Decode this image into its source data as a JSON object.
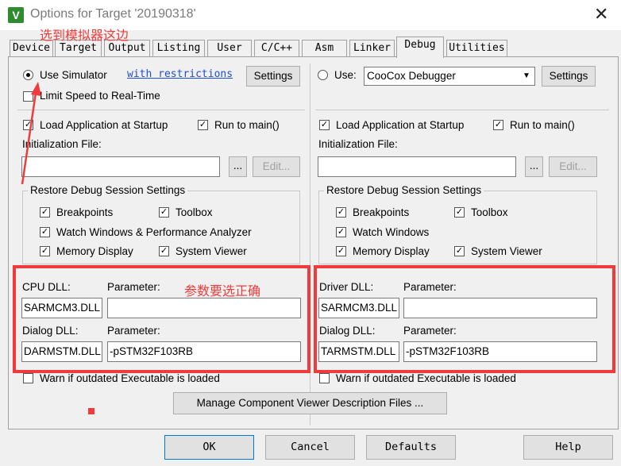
{
  "window": {
    "title": "Options for Target '20190318'",
    "icon": "keil-app-icon",
    "close_label": "✕"
  },
  "tabs": [
    "Device",
    "Target",
    "Output",
    "Listing",
    "User",
    "C/C++",
    "Asm",
    "Linker",
    "Debug",
    "Utilities"
  ],
  "active_tab": "Debug",
  "annotations": {
    "select_simulator": "选到模拟器这边",
    "params_correct": "参数要选正确",
    "accent_color": "#ef3b3b"
  },
  "left": {
    "use_simulator": "Use Simulator",
    "restrictions_link": "with restrictions",
    "settings": "Settings",
    "limit_speed": "Limit Speed to Real-Time",
    "load_app": "Load Application at Startup",
    "run_to_main": "Run to main()",
    "init_file": "Initialization File:",
    "browse": "...",
    "edit": "Edit...",
    "restore_group": "Restore Debug Session Settings",
    "breakpoints": "Breakpoints",
    "toolbox": "Toolbox",
    "watch": "Watch Windows & Performance Analyzer",
    "memory": "Memory Display",
    "system_viewer": "System Viewer",
    "cpu_dll": "CPU DLL:",
    "parameter": "Parameter:",
    "cpu_dll_value": "SARMCM3.DLL",
    "cpu_param_value": "",
    "dialog_dll": "Dialog DLL:",
    "dialog_dll_value": "DARMSTM.DLL",
    "dialog_param_value": "-pSTM32F103RB",
    "warn": "Warn if outdated Executable is loaded"
  },
  "right": {
    "use": "Use:",
    "debugger": "CooCox Debugger",
    "settings": "Settings",
    "load_app": "Load Application at Startup",
    "run_to_main": "Run to main()",
    "init_file": "Initialization File:",
    "browse": "...",
    "edit": "Edit...",
    "restore_group": "Restore Debug Session Settings",
    "breakpoints": "Breakpoints",
    "toolbox": "Toolbox",
    "watch": "Watch Windows",
    "memory": "Memory Display",
    "system_viewer": "System Viewer",
    "driver_dll": "Driver DLL:",
    "parameter": "Parameter:",
    "driver_dll_value": "SARMCM3.DLL",
    "driver_param_value": "",
    "dialog_dll": "Dialog DLL:",
    "dialog_dll_value": "TARMSTM.DLL",
    "dialog_param_value": "-pSTM32F103RB",
    "warn": "Warn if outdated Executable is loaded"
  },
  "manage_button": "Manage Component Viewer Description Files ...",
  "footer": {
    "ok": "OK",
    "cancel": "Cancel",
    "defaults": "Defaults",
    "help": "Help"
  }
}
